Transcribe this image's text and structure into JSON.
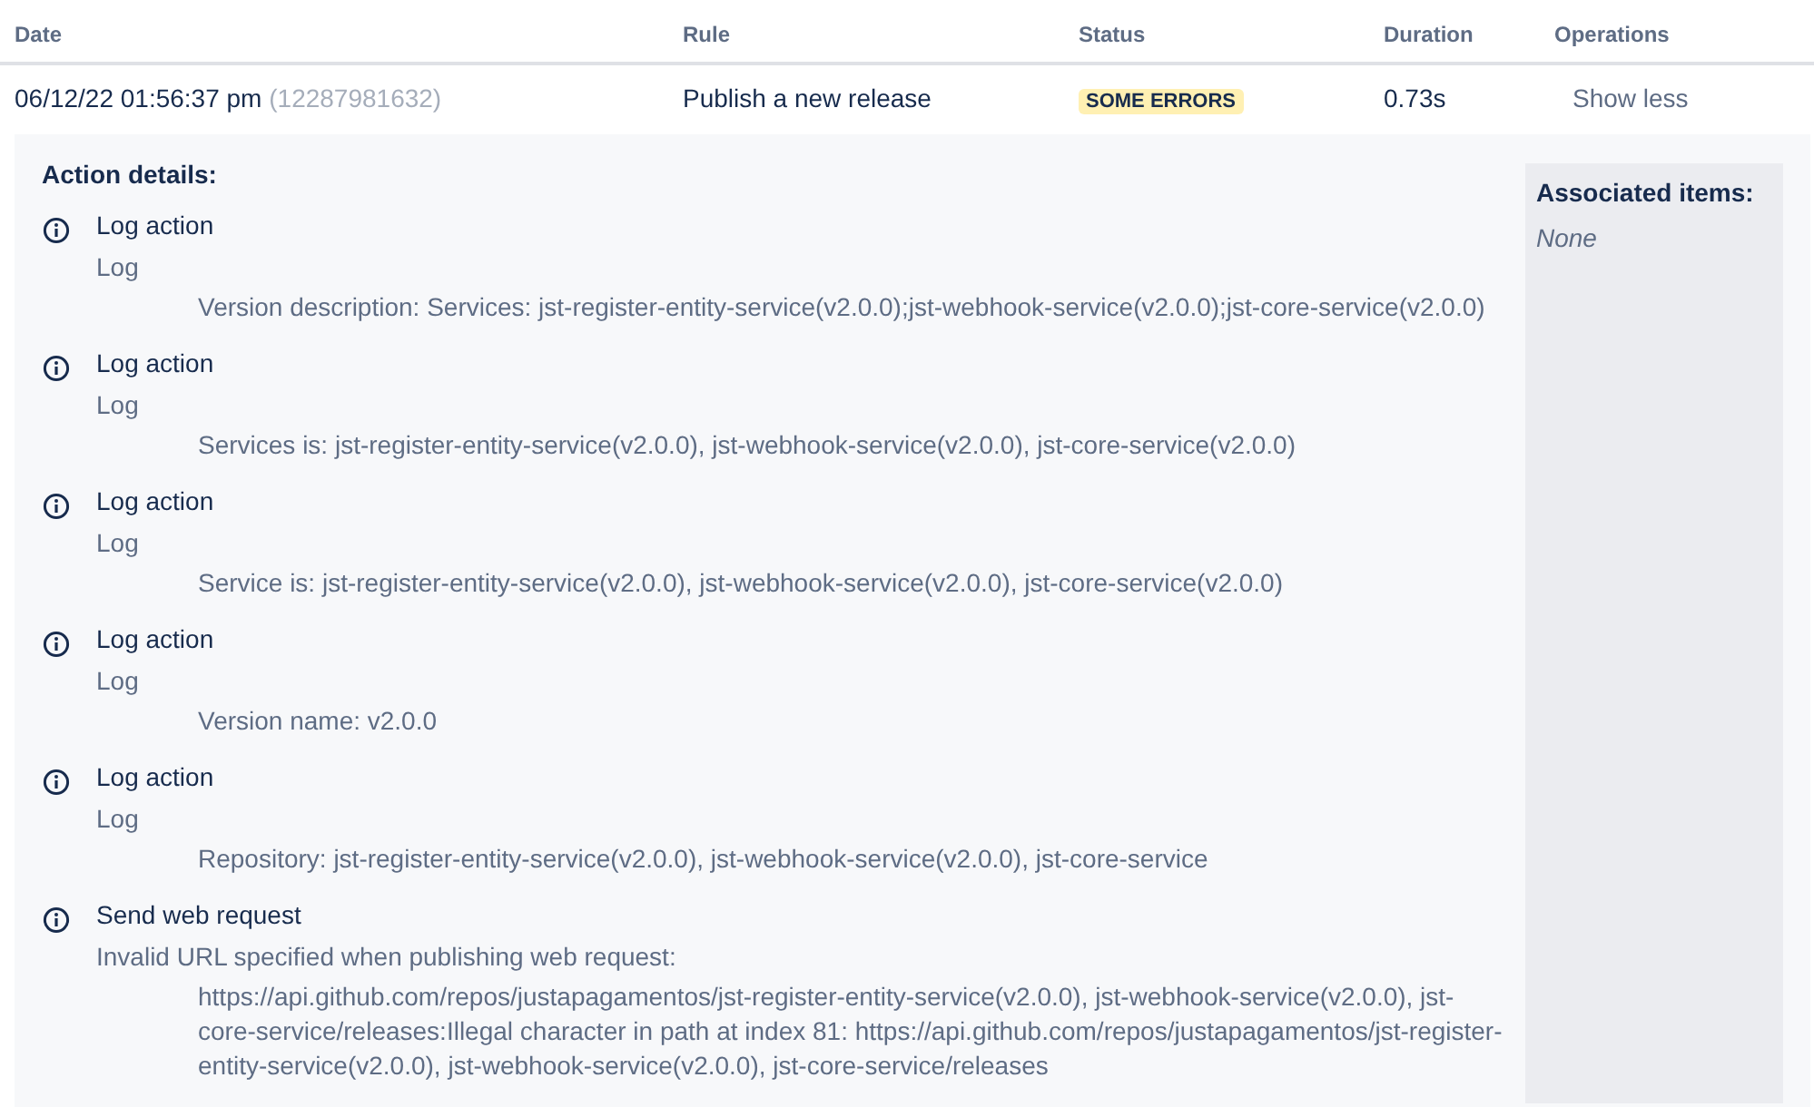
{
  "table": {
    "columns": [
      "Date",
      "Rule",
      "Status",
      "Duration",
      "Operations"
    ],
    "row": {
      "date": "06/12/22 01:56:37 pm",
      "execution_id": "(12287981632)",
      "rule": "Publish a new release",
      "status": "SOME ERRORS",
      "duration": "0.73s",
      "operation": "Show less"
    }
  },
  "details": {
    "title": "Action details:",
    "actions": [
      {
        "title": "Log action",
        "subtitle": "Log",
        "message": "Version description: Services: jst-register-entity-service(v2.0.0);jst-webhook-service(v2.0.0);jst-core-service(v2.0.0)"
      },
      {
        "title": "Log action",
        "subtitle": "Log",
        "message": "Services is: jst-register-entity-service(v2.0.0), jst-webhook-service(v2.0.0), jst-core-service(v2.0.0)"
      },
      {
        "title": "Log action",
        "subtitle": "Log",
        "message": "Service is: jst-register-entity-service(v2.0.0), jst-webhook-service(v2.0.0), jst-core-service(v2.0.0)"
      },
      {
        "title": "Log action",
        "subtitle": "Log",
        "message": "Version name: v2.0.0"
      },
      {
        "title": "Log action",
        "subtitle": "Log",
        "message": "Repository: jst-register-entity-service(v2.0.0), jst-webhook-service(v2.0.0), jst-core-service"
      },
      {
        "title": "Send web request",
        "subtitle": "Invalid URL specified when publishing web request:",
        "message": "https://api.github.com/repos/justapagamentos/jst-register-entity-service(v2.0.0), jst-webhook-service(v2.0.0), jst-core-service/releases:Illegal character in path at index 81: https://api.github.com/repos/justapagamentos/jst-register-entity-service(v2.0.0), jst-webhook-service(v2.0.0), jst-core-service/releases"
      }
    ],
    "associated": {
      "title": "Associated items:",
      "value": "None"
    }
  }
}
